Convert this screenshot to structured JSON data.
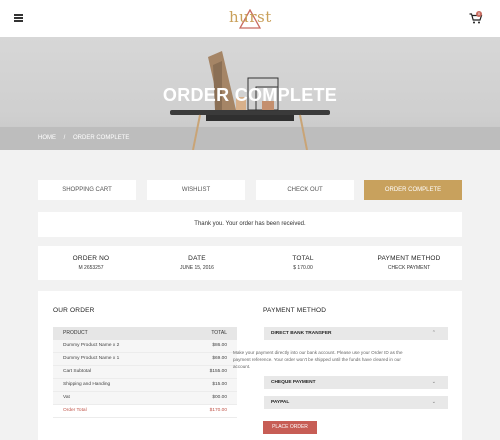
{
  "header": {
    "logo_text": "hurst",
    "cart_count": "0"
  },
  "hero": {
    "title": "ORDER COMPLETE",
    "breadcrumb": [
      "HOME",
      "/",
      "ORDER COMPLETE"
    ]
  },
  "steps": [
    "SHOPPING CART",
    "WISHLIST",
    "CHECK OUT",
    "ORDER COMPLETE"
  ],
  "notice": "Thank you. Your order has been received.",
  "summary": [
    {
      "label": "ORDER NO",
      "value": "M 2653257"
    },
    {
      "label": "DATE",
      "value": "JUNE 15, 2016"
    },
    {
      "label": "TOTAL",
      "value": "$ 170.00"
    },
    {
      "label": "PAYMENT METHOD",
      "value": "CHECK PAYMENT"
    }
  ],
  "our_order": {
    "title": "OUR ORDER",
    "columns": [
      "PRODUCT",
      "TOTAL"
    ],
    "rows": [
      {
        "product": "Dummy Product Name x 2",
        "total": "$86.00"
      },
      {
        "product": "Dummy Product Name x 1",
        "total": "$69.00"
      },
      {
        "product": "Cart Subtotal",
        "total": "$155.00"
      },
      {
        "product": "Shipping and Handing",
        "total": "$15.00"
      },
      {
        "product": "Vat",
        "total": "$00.00"
      },
      {
        "product": "Order Total",
        "total": "$170.00"
      }
    ]
  },
  "payment": {
    "title": "PAYMENT METHOD",
    "methods": [
      "DIRECT BANK TRANSFER",
      "CHEQUE PAYMENT",
      "PAYPAL"
    ],
    "description": "Make your payment directly into our bank account. Please use your Order ID as the payment reference. Your order won't be shipped until the funds have cleared in our account.",
    "place_order": "PLACE ORDER"
  },
  "colors": {
    "accent": "#c8a15d",
    "button": "#c75d55",
    "total_text": "#c0554a"
  }
}
